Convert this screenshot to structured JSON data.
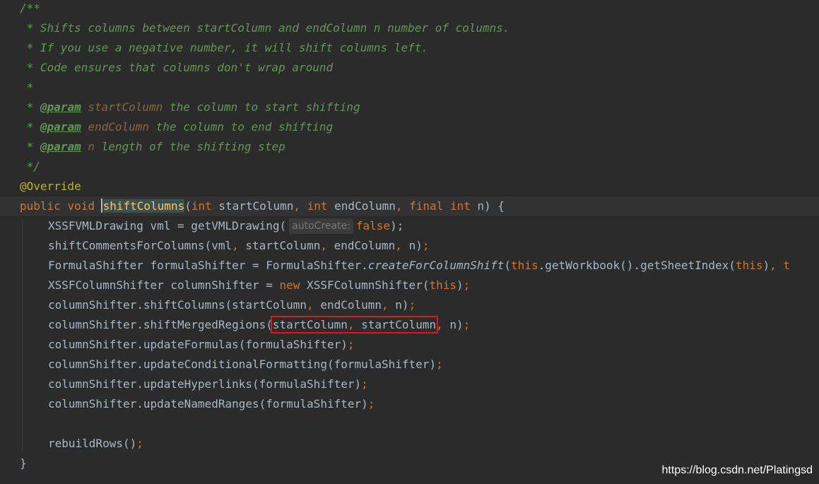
{
  "editor": {
    "doc_comment": {
      "open": "/**",
      "line1": " * Shifts columns between startColumn and endColumn n number of columns.",
      "line2": " * If you use a negative number, it will shift columns left.",
      "line3": " * Code ensures that columns don't wrap around",
      "line4": " *",
      "star": " * ",
      "param_tag": "@param",
      "params": [
        {
          "name": "startColumn",
          "desc": " the column to start shifting"
        },
        {
          "name": "endColumn",
          "desc": " the column to end shifting"
        },
        {
          "name": "n",
          "desc": " length of the shifting step"
        }
      ],
      "close": " */"
    },
    "annotation": "@Override",
    "signature": {
      "kw_public": "public",
      "kw_void": "void",
      "method": "shiftColumns",
      "open": "(",
      "kw_int1": "int",
      "p1": " startColumn",
      "comma1": ",",
      "kw_int2": "int",
      "p2": " endColumn",
      "comma2": ",",
      "kw_final": "final",
      "kw_int3": "int",
      "p3": " n) {"
    },
    "body": {
      "l1_pre": "XSSFVMLDrawing vml = getVMLDrawing(",
      "l1_hint": "autoCreate:",
      "l1_kw": "false",
      "l1_post": ");",
      "l2_pre": "shiftCommentsForColumns(vml",
      "l2_c1": ",",
      "l2_a": " startColumn",
      "l2_c2": ",",
      "l2_b": " endColumn",
      "l2_c3": ",",
      "l2_post": " n)",
      "l2_semi": ";",
      "l3_pre": "FormulaShifter formulaShifter = FormulaShifter.",
      "l3_call": "createForColumnShift",
      "l3_open": "(",
      "l3_this1": "this",
      "l3_mid": ".getWorkbook().getSheetIndex(",
      "l3_this2": "this",
      "l3_close": ")",
      "l3_c": ",",
      "l3_tail": " t",
      "l4_pre": "XSSFColumnShifter columnShifter = ",
      "l4_new": "new",
      "l4_mid": " XSSFColumnShifter(",
      "l4_this": "this",
      "l4_post": ")",
      "l4_semi": ";",
      "l5_pre": "columnShifter.shiftColumns(startColumn",
      "l5_c1": ",",
      "l5_a": " endColumn",
      "l5_c2": ",",
      "l5_post": " n)",
      "l5_semi": ";",
      "l6_pre": "columnShifter.shiftMergedRegions(",
      "l6_boxed_a": "startColumn",
      "l6_boxed_c": ",",
      "l6_boxed_b": " startColumn",
      "l6_c": ",",
      "l6_post": " n)",
      "l6_semi": ";",
      "l7": "columnShifter.updateFormulas(formulaShifter)",
      "l8": "columnShifter.updateConditionalFormatting(formulaShifter)",
      "l9": "columnShifter.updateHyperlinks(formulaShifter)",
      "l10": "columnShifter.updateNamedRanges(formulaShifter)",
      "semi": ";",
      "l11": "rebuildRows()",
      "close_brace": "}"
    }
  },
  "watermark": "https://blog.csdn.net/Platingsd",
  "colors": {
    "background": "#2b2b2b",
    "doc_comment": "#629755",
    "keyword": "#cc7832",
    "annotation": "#bbb529",
    "method_declaration": "#ffc66d",
    "plain_text": "#a9b7c6",
    "highlight_box": "#e0161b"
  }
}
